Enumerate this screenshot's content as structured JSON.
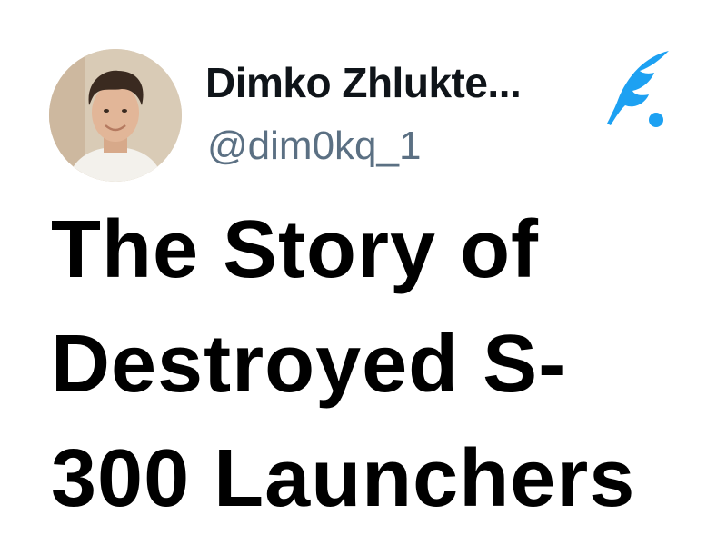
{
  "author": {
    "name": "Dimko Zhlukte...",
    "handle": "@dim0kq_1"
  },
  "brand": {
    "icon": "quill-feather-icon",
    "color": "#1da1f2"
  },
  "post": {
    "title_lines": [
      "The Story of",
      "Destroyed S-",
      "300 Launchers"
    ]
  }
}
